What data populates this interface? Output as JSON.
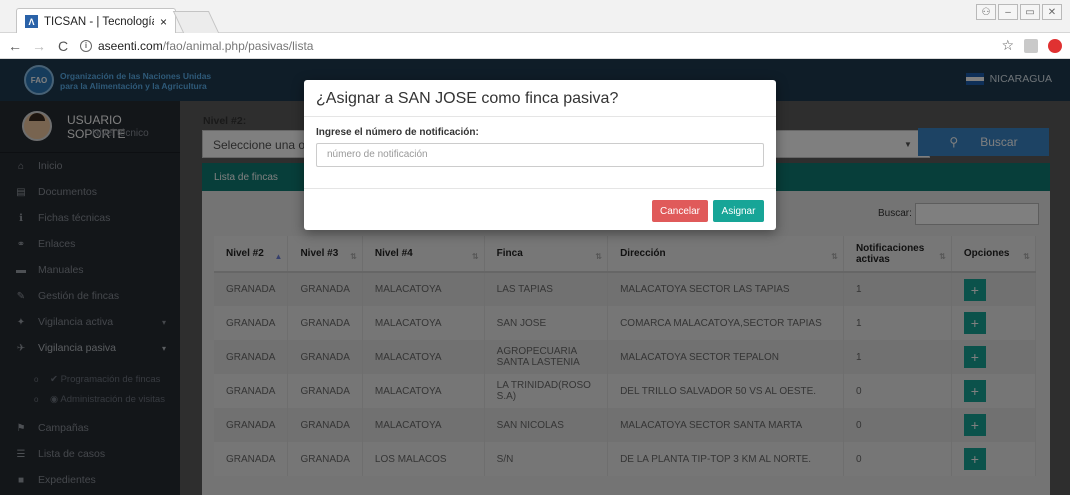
{
  "browser": {
    "tab_title": "TICSAN - | Tecnología de",
    "tab_close": "×",
    "url_host": "aseenti.com",
    "url_path": "/fao/animal.php/pasivas/lista",
    "back": "←",
    "forward": "→",
    "reload": "C",
    "star": "☆",
    "info": "i"
  },
  "header": {
    "org_line1": "Organización de las Naciones Unidas",
    "org_line2": "para la Alimentación y la Agricultura",
    "logo_text": "FAO",
    "country": "NICARAGUA"
  },
  "user": {
    "name": "USUARIO SOPORTE",
    "role": "Nivel técnico"
  },
  "sidebar": {
    "items": [
      {
        "label": "Inicio",
        "icon": "⌂"
      },
      {
        "label": "Documentos",
        "icon": "▤"
      },
      {
        "label": "Fichas técnicas",
        "icon": "ℹ"
      },
      {
        "label": "Enlaces",
        "icon": "⚭"
      },
      {
        "label": "Manuales",
        "icon": "▬"
      },
      {
        "label": "Gestión de fincas",
        "icon": "✎"
      },
      {
        "label": "Vigilancia activa",
        "icon": "✦",
        "caret": "▾"
      },
      {
        "label": "Vigilancia pasiva",
        "icon": "✈",
        "caret": "▾"
      }
    ],
    "subitems": [
      {
        "label": "✔ Programación de fincas",
        "dot": "o"
      },
      {
        "label": "◉ Administración de visitas",
        "dot": "o"
      }
    ],
    "items2": [
      {
        "label": "Campañas",
        "icon": "⚑"
      },
      {
        "label": "Lista de casos",
        "icon": "☰"
      },
      {
        "label": "Expedientes",
        "icon": "■"
      }
    ]
  },
  "main": {
    "level_label": "Nivel #2:",
    "select_value": "Seleccione una op",
    "search_btn": "Buscar",
    "search_icon": "⚲",
    "panel_title": "Lista de fincas",
    "buscar_label": "Buscar:",
    "table": {
      "headers": [
        "Nivel #2",
        "Nivel #3",
        "Nivel #4",
        "Finca",
        "Dirección",
        "Notificaciones activas",
        "Opciones"
      ],
      "rows": [
        [
          "GRANADA",
          "GRANADA",
          "MALACATOYA",
          "LAS TAPIAS",
          "MALACATOYA SECTOR LAS TAPIAS",
          "1"
        ],
        [
          "GRANADA",
          "GRANADA",
          "MALACATOYA",
          "SAN JOSE",
          "COMARCA MALACATOYA,SECTOR TAPIAS",
          "1"
        ],
        [
          "GRANADA",
          "GRANADA",
          "MALACATOYA",
          "AGROPECUARIA SANTA LASTENIA",
          "MALACATOYA SECTOR TEPALON",
          "1"
        ],
        [
          "GRANADA",
          "GRANADA",
          "MALACATOYA",
          "LA TRINIDAD(ROSO S.A)",
          "DEL TRILLO SALVADOR 50 VS AL OESTE.",
          "0"
        ],
        [
          "GRANADA",
          "GRANADA",
          "MALACATOYA",
          "SAN NICOLAS",
          "MALACATOYA SECTOR SANTA MARTA",
          "0"
        ],
        [
          "GRANADA",
          "GRANADA",
          "LOS MALACOS",
          "S/N",
          "DE LA PLANTA TIP-TOP 3 KM AL NORTE.",
          "0"
        ]
      ],
      "plus_label": "+"
    }
  },
  "modal": {
    "title": "¿Asignar a SAN JOSE como finca pasiva?",
    "label": "Ingrese el número de notificación:",
    "placeholder": "número de notificación",
    "cancel": "Cancelar",
    "assign": "Asignar"
  }
}
